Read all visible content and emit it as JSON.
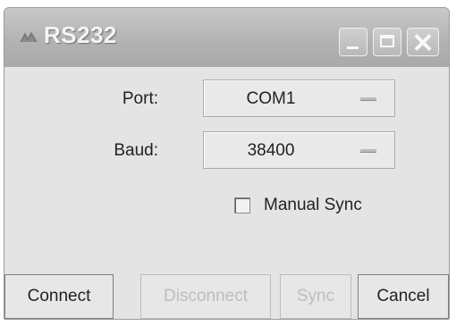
{
  "window": {
    "title": "RS232",
    "icons": {
      "app": "app-icon",
      "minimize": "minimize-icon",
      "maximize": "maximize-icon",
      "close": "close-icon"
    }
  },
  "form": {
    "port": {
      "label": "Port:",
      "value": "COM1"
    },
    "baud": {
      "label": "Baud:",
      "value": "38400"
    },
    "manual_sync": {
      "label": "Manual Sync",
      "checked": false
    }
  },
  "buttons": {
    "connect": {
      "label": "Connect",
      "enabled": true
    },
    "disconnect": {
      "label": "Disconnect",
      "enabled": false
    },
    "sync": {
      "label": "Sync",
      "enabled": false
    },
    "cancel": {
      "label": "Cancel",
      "enabled": true
    }
  }
}
